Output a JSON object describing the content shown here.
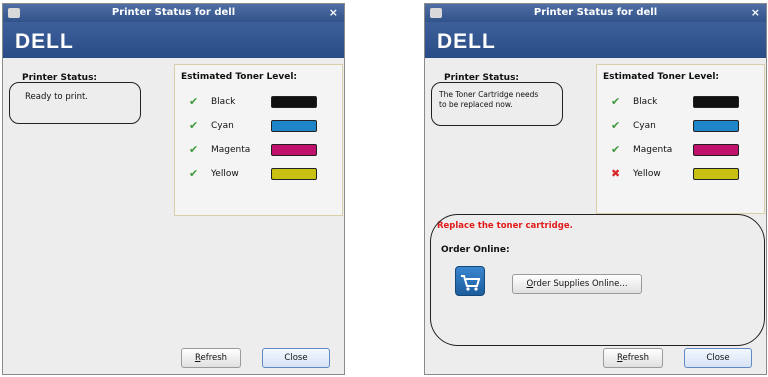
{
  "dialogs": [
    {
      "title": "Printer Status for dell",
      "logo": "DELL",
      "status_label": "Printer Status:",
      "status_text": "Ready to print.",
      "toner_label": "Estimated Toner Level:",
      "toners": [
        {
          "name": "Black",
          "status": "ok",
          "color": "#111111"
        },
        {
          "name": "Cyan",
          "status": "ok",
          "color": "#1e86c8"
        },
        {
          "name": "Magenta",
          "status": "ok",
          "color": "#c0126c"
        },
        {
          "name": "Yellow",
          "status": "ok",
          "color": "#c8c012"
        }
      ],
      "refresh_label_first": "R",
      "refresh_label_rest": "efresh",
      "close_label": "Close"
    },
    {
      "title": "Printer Status for dell",
      "logo": "DELL",
      "status_label": "Printer Status:",
      "status_text_line1": "The Toner Cartridge needs",
      "status_text_line2": "to be replaced now.",
      "toner_label": "Estimated Toner Level:",
      "toners": [
        {
          "name": "Black",
          "status": "ok",
          "color": "#111111"
        },
        {
          "name": "Cyan",
          "status": "ok",
          "color": "#1e86c8"
        },
        {
          "name": "Magenta",
          "status": "ok",
          "color": "#c0126c"
        },
        {
          "name": "Yellow",
          "status": "error",
          "color": "#c8c012"
        }
      ],
      "warning": "Replace the toner cartridge.",
      "order_label": "Order Online:",
      "order_button_first": "O",
      "order_button_rest": "rder Supplies Online...",
      "refresh_label_first": "R",
      "refresh_label_rest": "efresh",
      "close_label": "Close"
    }
  ],
  "icons": {
    "ok": "check-icon",
    "error": "error-icon",
    "cart": "cart-icon"
  }
}
